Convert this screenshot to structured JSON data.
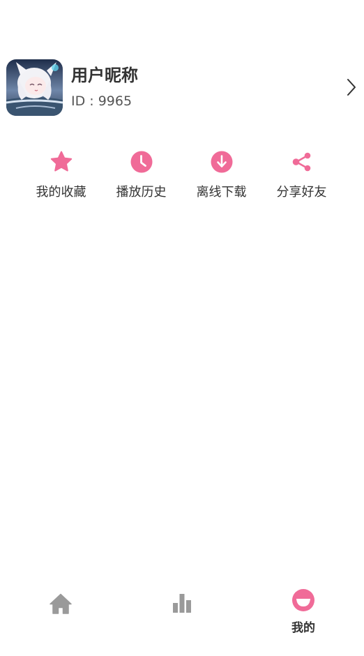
{
  "profile": {
    "nickname": "用户昵称",
    "id_text": "ID : 9965",
    "avatar_icon": "anime-avatar"
  },
  "actions": [
    {
      "label": "我的收藏",
      "icon": "star-icon",
      "color": "#f06b98"
    },
    {
      "label": "播放历史",
      "icon": "clock-icon",
      "color": "#f06b98"
    },
    {
      "label": "离线下载",
      "icon": "download-icon",
      "color": "#f06b98"
    },
    {
      "label": "分享好友",
      "icon": "share-icon",
      "color": "#f06b98"
    }
  ],
  "tabbar": {
    "tabs": [
      {
        "icon": "home-icon",
        "active": false
      },
      {
        "icon": "chart-icon",
        "active": false
      },
      {
        "icon": "smile-icon",
        "label": "我的",
        "active": true
      }
    ]
  },
  "colors": {
    "accent": "#f06b98",
    "inactive_icon": "#9a9a9a",
    "text": "#333333"
  }
}
